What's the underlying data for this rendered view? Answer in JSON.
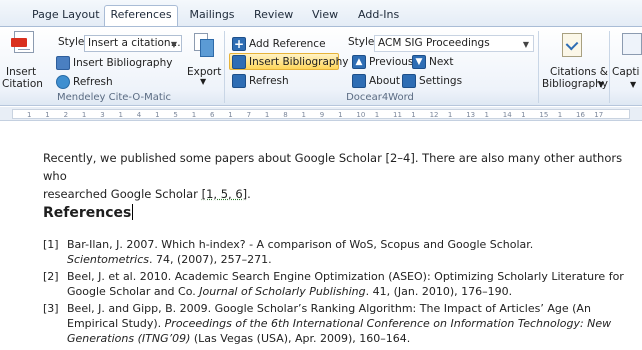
{
  "tabs": [
    "Page Layout",
    "References",
    "Mailings",
    "Review",
    "View",
    "Add-Ins"
  ],
  "active_tab": "References",
  "ribbon": {
    "mendeley": {
      "style_label": "Style:",
      "style_value": "Insert a citation...",
      "insert_citation": [
        "Insert",
        "Citation"
      ],
      "insert_bibliography": "Insert Bibliography",
      "refresh": "Refresh",
      "export": "Export",
      "group_label": "Mendeley Cite-O-Matic"
    },
    "docear": {
      "add_reference": "Add Reference",
      "insert_bibliography": "Insert Bibliography",
      "refresh": "Refresh",
      "style_label": "Style:",
      "style_value": "ACM SIG Proceedings",
      "previous": "Previous",
      "next": "Next",
      "about": "About",
      "settings": "Settings",
      "group_label": "Docear4Word"
    },
    "citations": [
      "Citations &",
      "Bibliography"
    ],
    "caption": "Capti"
  },
  "ruler_ticks": [
    "1",
    "1",
    "2",
    "1",
    "3",
    "1",
    "4",
    "1",
    "5",
    "1",
    "6",
    "1",
    "7",
    "1",
    "8",
    "1",
    "9",
    "1",
    "10",
    "1",
    "11",
    "1",
    "12",
    "1",
    "13",
    "1",
    "14",
    "1",
    "15",
    "1",
    "16",
    "17"
  ],
  "document": {
    "para_line1": "Recently, we published some papers about Google Scholar [2–4]. There are also many other authors who",
    "para_line2_pre": "researched Google Scholar ",
    "para_line2_cite": "[1, 5, 6]",
    "para_line2_post": ".",
    "heading": "References",
    "refs": [
      {
        "num": "[1]",
        "l1": "Bar-Ilan, J. 2007.  Which h-index? - A comparison of WoS, Scopus and Google Scholar.",
        "l2_it": "Scientometrics",
        "l2_rest": ". 74, (2007), 257–271."
      },
      {
        "num": "[2]",
        "l1": "Beel, J. et al. 2010.  Academic Search Engine Optimization (ASEO): Optimizing Scholarly Literature for",
        "l2_pre": "Google Scholar and Co. ",
        "l2_it": "Journal of Scholarly Publishing",
        "l2_rest": ". 41, (Jan. 2010), 176–190."
      },
      {
        "num": "[3]",
        "l1": "Beel, J. and Gipp, B. 2009.  Google Scholar’s Ranking Algorithm: The Impact of Articles’ Age (An",
        "l2_pre": "Empirical Study). ",
        "l2_it": "Proceedings of the 6th International Conference on Information Technology: New",
        "l3_it": "Generations (ITNG’09)",
        "l3_rest": " (Las Vegas (USA), Apr. 2009), 160–164."
      }
    ]
  }
}
